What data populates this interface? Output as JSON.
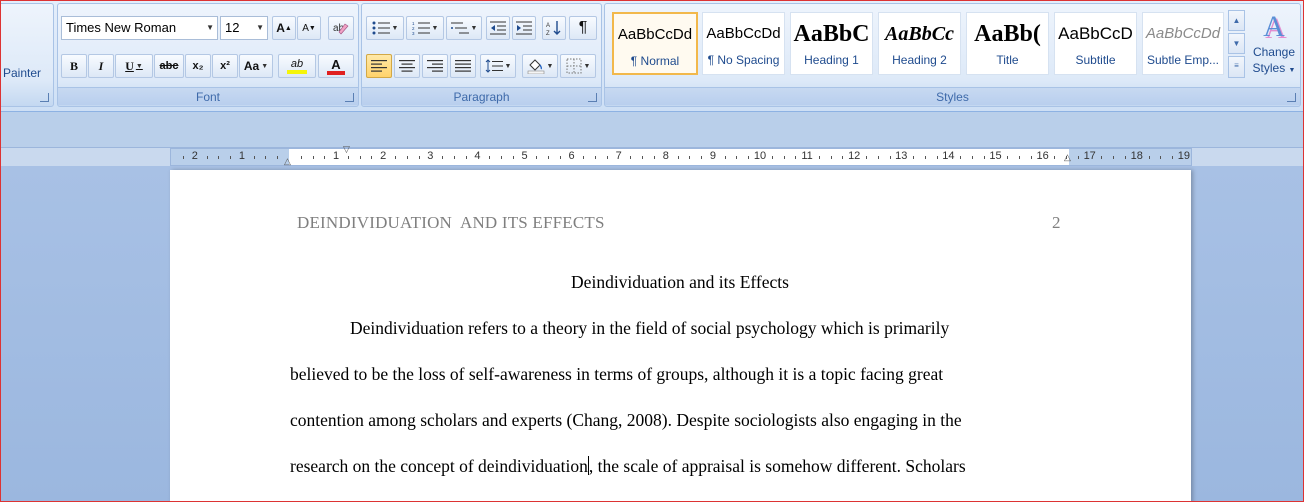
{
  "clipboard": {
    "painter_label": "Painter"
  },
  "font": {
    "group_label": "Font",
    "family": "Times New Roman",
    "size": "12",
    "grow_label": "A",
    "shrink_label": "A",
    "bold": "B",
    "italic": "I",
    "underline": "U",
    "strike": "abc",
    "subscript": "x₂",
    "superscript": "x²",
    "case": "Aa",
    "highlight": "ab",
    "font_color": "A",
    "highlight_color": "#f5f50a",
    "font_color_value": "#e02020"
  },
  "paragraph": {
    "group_label": "Paragraph",
    "pilcrow": "¶",
    "align_active": "left"
  },
  "styles": {
    "group_label": "Styles",
    "tiles": [
      {
        "sample": "AaBbCcDd",
        "name": "¶ Normal",
        "selected": true
      },
      {
        "sample": "AaBbCcDd",
        "name": "¶ No Spacing"
      },
      {
        "sample": "AaBbC",
        "name": "Heading 1"
      },
      {
        "sample": "AaBbCc",
        "name": "Heading 2"
      },
      {
        "sample": "AaBb(",
        "name": "Title"
      },
      {
        "sample": "AaBbCcD",
        "name": "Subtitle"
      },
      {
        "sample": "AaBbCcDd",
        "name": "Subtle Emp..."
      }
    ],
    "change_styles_line1": "Change",
    "change_styles_line2": "Styles",
    "change_styles_icon_label": "A"
  },
  "ruler": {
    "left_numbers": [
      "2",
      "1"
    ],
    "right_numbers": [
      "1",
      "2",
      "3",
      "4",
      "5",
      "6",
      "7",
      "8",
      "9",
      "10",
      "11",
      "12",
      "13",
      "14",
      "15",
      "16",
      "17",
      "18",
      "19"
    ]
  },
  "document": {
    "header_text": "DEINDIVIDUATION  AND ITS EFFECTS",
    "page_number": "2",
    "title": "Deindividuation and its Effects",
    "lines": [
      "Deindividuation refers to a theory in the field of social psychology which is primarily",
      "believed to be the loss of self-awareness in terms of groups, although it is a topic facing great",
      "contention among scholars and experts (Chang, 2008). Despite sociologists also engaging in the"
    ],
    "line4_before_caret": "research on the concept of deindividuation",
    "line4_after_caret": ", the scale of appraisal is somehow different. Scholars"
  }
}
